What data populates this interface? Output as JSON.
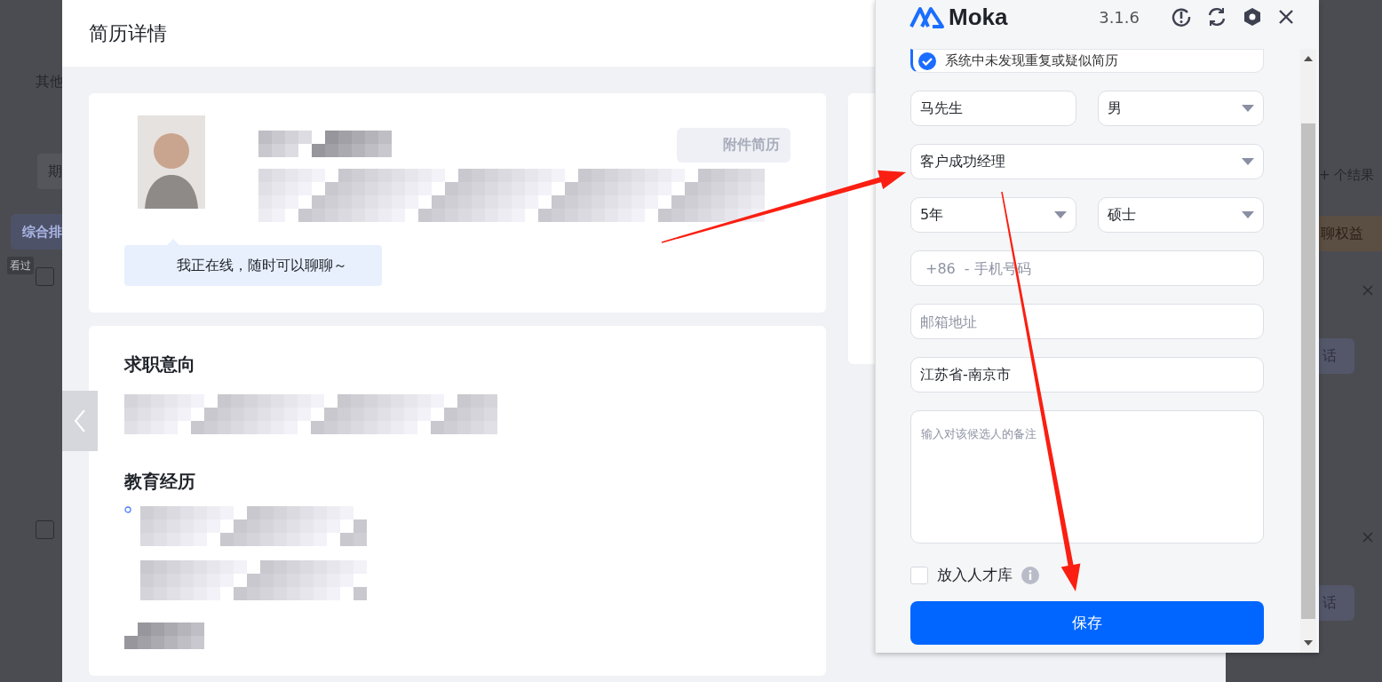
{
  "backdrop": {
    "left": {
      "label": "其他",
      "filter_button": "期",
      "sort_tab": "综合排",
      "seen_tag": "看过",
      "rows": [
        {
          "checked": false
        },
        {
          "checked": false
        }
      ]
    },
    "right": {
      "result_count": "+ 个结果",
      "benefit_banner": "聊权益",
      "actions": [
        {
          "label": "话"
        },
        {
          "label": "话"
        }
      ]
    }
  },
  "modal": {
    "title": "简历详情",
    "attachment_button": "附件简历",
    "status_bubble": "我正在线，随时可以聊聊～",
    "sections": [
      {
        "heading": "求职意向"
      },
      {
        "heading": "教育经历"
      }
    ]
  },
  "plugin": {
    "brand": "Moka",
    "version": "3.1.6",
    "notice": {
      "text": "系统中未发现重复或疑似简历",
      "checked": true
    },
    "rows": [
      [
        {
          "kind": "text",
          "value": "马先生"
        },
        {
          "kind": "select",
          "value": "男"
        }
      ],
      [
        {
          "kind": "select",
          "value": "客户成功经理"
        }
      ],
      [
        {
          "kind": "select",
          "value": "5年"
        },
        {
          "kind": "select",
          "value": "硕士"
        }
      ],
      [
        {
          "kind": "phone",
          "prefix": "+86",
          "placeholder": "- 手机号码"
        }
      ],
      [
        {
          "kind": "text",
          "placeholder": "邮箱地址"
        }
      ],
      [
        {
          "kind": "text",
          "value": "江苏省-南京市"
        }
      ],
      [
        {
          "kind": "textarea",
          "placeholder": "输入对该候选人的备注"
        }
      ]
    ],
    "talent_pool": {
      "label": "放入人才库",
      "checked": false
    },
    "save_button": "保存"
  }
}
